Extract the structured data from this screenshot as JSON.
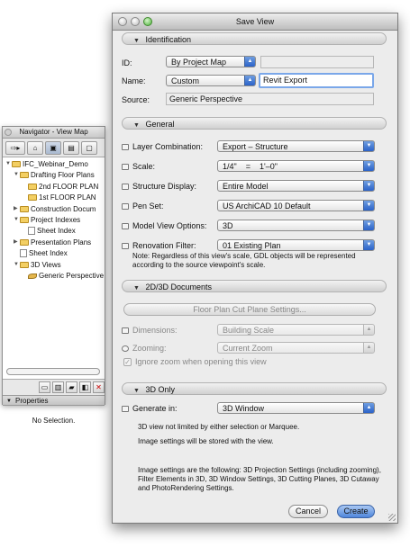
{
  "navigator": {
    "title": "Navigator - View Map",
    "tree": [
      {
        "label": "IFC_Webinar_Demo",
        "kind": "project",
        "indent": 0,
        "expanded": true
      },
      {
        "label": "Drafting Floor Plans",
        "kind": "folder",
        "indent": 1,
        "expanded": true
      },
      {
        "label": "2nd FLOOR PLAN",
        "kind": "folder",
        "indent": 2
      },
      {
        "label": "1st FLOOR PLAN",
        "kind": "folder",
        "indent": 2
      },
      {
        "label": "Construction Docum",
        "kind": "folder",
        "indent": 1,
        "expanded": false
      },
      {
        "label": "Project Indexes",
        "kind": "folder",
        "indent": 1,
        "expanded": true
      },
      {
        "label": "Sheet Index",
        "kind": "doc",
        "indent": 2
      },
      {
        "label": "Presentation Plans",
        "kind": "folder",
        "indent": 1,
        "expanded": false
      },
      {
        "label": "Sheet Index",
        "kind": "doc",
        "indent": 1
      },
      {
        "label": "3D Views",
        "kind": "folder",
        "indent": 1,
        "expanded": true
      },
      {
        "label": "Generic Perspective",
        "kind": "perspective",
        "indent": 2
      }
    ],
    "properties_label": "Properties",
    "no_selection": "No Selection."
  },
  "dialog": {
    "title": "Save View",
    "identification": {
      "header": "Identification",
      "id_label": "ID:",
      "id_value": "By Project Map",
      "id_field": "",
      "name_label": "Name:",
      "name_value": "Custom",
      "name_field": "Revit Export",
      "source_label": "Source:",
      "source_value": "Generic Perspective"
    },
    "general": {
      "header": "General",
      "rows": [
        {
          "label": "Layer Combination:",
          "value": "Export – Structure"
        },
        {
          "label": "Scale:",
          "value": "1/4\"    =    1'–0\""
        },
        {
          "label": "Structure Display:",
          "value": "Entire Model"
        },
        {
          "label": "Pen Set:",
          "value": "US ArchiCAD 10 Default"
        },
        {
          "label": "Model View Options:",
          "value": "3D"
        },
        {
          "label": "Renovation Filter:",
          "value": "01 Existing Plan"
        }
      ],
      "note": "Note: Regardless of this view's scale, GDL objects will be represented according to the source viewpoint's scale."
    },
    "docs2d3d": {
      "header": "2D/3D Documents",
      "cut_plane_button": "Floor Plan Cut Plane Settings...",
      "dimensions_label": "Dimensions:",
      "dimensions_value": "Building Scale",
      "zooming_label": "Zooming:",
      "zooming_value": "Current Zoom",
      "ignore_zoom_label": "Ignore zoom when opening this view"
    },
    "only3d": {
      "header": "3D Only",
      "generate_label": "Generate in:",
      "generate_value": "3D Window",
      "info1": "3D view not limited by either selection or Marquee.",
      "info2": "Image settings will be stored with the view.",
      "info3": "Image settings are the following: 3D Projection Settings (including zooming), Filter Elements in 3D, 3D Window Settings, 3D Cutting Planes, 3D Cutaway and PhotoRendering Settings."
    },
    "cancel_label": "Cancel",
    "create_label": "Create"
  }
}
